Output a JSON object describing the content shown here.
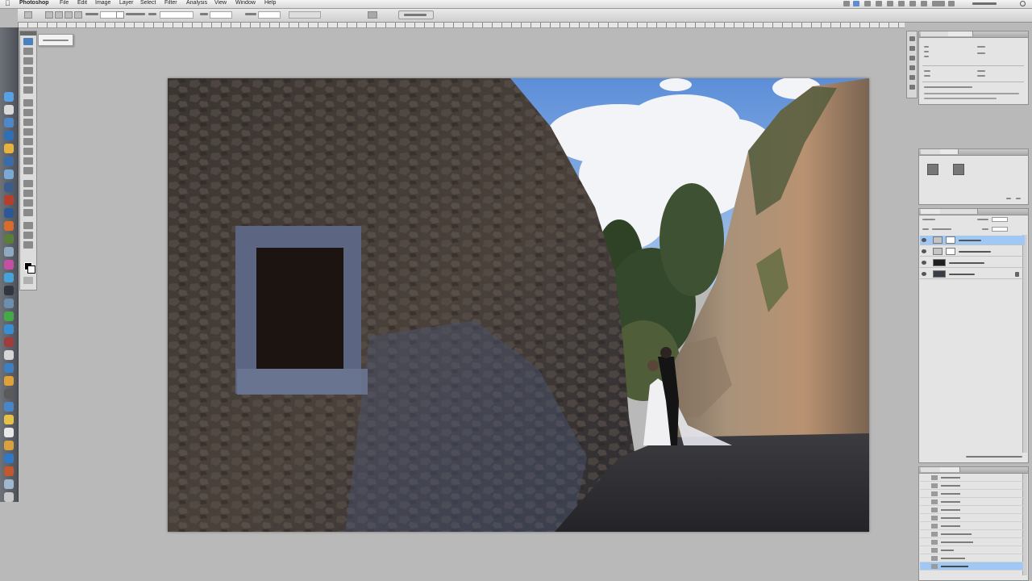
{
  "menu_bar": {
    "apple_icon": "apple-icon",
    "app_name": "Photoshop",
    "items": [
      "File",
      "Edit",
      "Image",
      "Layer",
      "Select",
      "Filter",
      "Analysis",
      "View",
      "Window",
      "Help"
    ],
    "status_icons": [
      "battery-icon",
      "wifi-icon",
      "volume-icon",
      "user-icon",
      "clock-icon"
    ],
    "spotlight_icon": "spotlight-icon"
  },
  "options_bar": {
    "workspace_switcher_icon": "workspace-icon"
  },
  "layers": [
    {
      "id": "levels-1",
      "selected": true
    },
    {
      "id": "hue-saturation-1",
      "selected": false
    },
    {
      "id": "background-copy",
      "selected": false
    },
    {
      "id": "background",
      "selected": false,
      "locked": true
    }
  ],
  "history": {
    "rows": 12,
    "selected_index": 11
  },
  "colors": {
    "ps_panel": "#e4e4e4",
    "canvas_bg": "#b9b9b9",
    "selection": "#9fc8f5",
    "dock": "#5c6066"
  }
}
